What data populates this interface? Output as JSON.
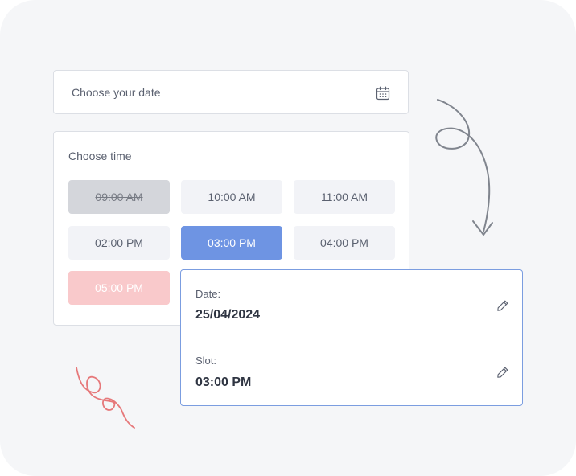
{
  "date_picker": {
    "placeholder": "Choose your date",
    "icon": "calendar-icon"
  },
  "time_picker": {
    "title": "Choose time",
    "slots": [
      {
        "label": "09:00 AM",
        "state": "disabled"
      },
      {
        "label": "10:00 AM",
        "state": "available"
      },
      {
        "label": "11:00 AM",
        "state": "available"
      },
      {
        "label": "02:00 PM",
        "state": "available"
      },
      {
        "label": "03:00 PM",
        "state": "selected"
      },
      {
        "label": "04:00 PM",
        "state": "available"
      },
      {
        "label": "05:00 PM",
        "state": "unavailable"
      }
    ]
  },
  "summary": {
    "date_label": "Date:",
    "date_value": "25/04/2024",
    "slot_label": "Slot:",
    "slot_value": "03:00 PM",
    "edit_icon": "pencil-icon"
  },
  "colors": {
    "selected": "#6e94e3",
    "disabled": "#d4d6db",
    "unavailable": "#f9c9cb",
    "summary_border": "#7b9de0",
    "canvas": "#f5f6f8"
  }
}
